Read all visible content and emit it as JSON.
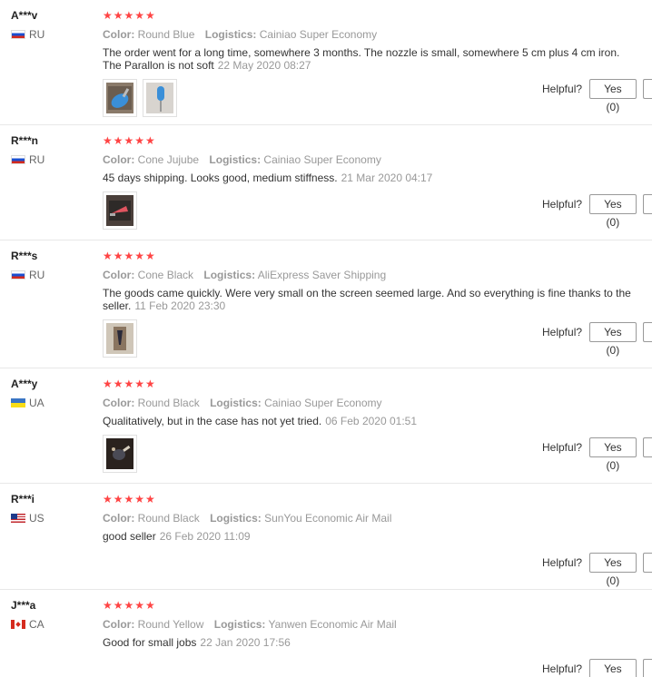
{
  "labels": {
    "color": "Color:",
    "logistics": "Logistics:",
    "helpful": "Helpful?",
    "yes": "Yes (0)",
    "stars": "★★★★★"
  },
  "reviews": [
    {
      "user": "A***v",
      "country": "RU",
      "flag": "russia-flag",
      "color": "Round Blue",
      "logistics": "Cainiao Super Economy",
      "text": "The order went for a long time, somewhere 3 months. The nozzle is small, somewhere 5 cm plus 4 cm iron. The Parallon is not soft",
      "date": "22 May 2020 08:27",
      "photos": [
        "blue-nozzle-photo",
        "blue-drill-bit-photo"
      ]
    },
    {
      "user": "R***n",
      "country": "RU",
      "flag": "russia-flag",
      "color": "Cone Jujube",
      "logistics": "Cainiao Super Economy",
      "text": "45 days shipping. Looks good, medium stiffness.",
      "date": "21 Mar 2020 04:17",
      "photos": [
        "red-cone-photo"
      ]
    },
    {
      "user": "R***s",
      "country": "RU",
      "flag": "russia-flag",
      "color": "Cone Black",
      "logistics": "AliExpress Saver Shipping",
      "text": "The goods came quickly. Were very small on the screen seemed large. And so everything is fine thanks to the seller.",
      "date": "11 Feb 2020 23:30",
      "photos": [
        "black-cone-photo"
      ]
    },
    {
      "user": "A***y",
      "country": "UA",
      "flag": "ukraine-flag",
      "color": "Round Black",
      "logistics": "Cainiao Super Economy",
      "text": "Qualitatively, but in the case has not yet tried.",
      "date": "06 Feb 2020 01:51",
      "photos": [
        "black-round-photo"
      ]
    },
    {
      "user": "R***i",
      "country": "US",
      "flag": "usa-flag",
      "color": "Round Black",
      "logistics": "SunYou Economic Air Mail",
      "text": "good seller",
      "date": "26 Feb 2020 11:09",
      "photos": []
    },
    {
      "user": "J***a",
      "country": "CA",
      "flag": "canada-flag",
      "color": "Round Yellow",
      "logistics": "Yanwen Economic Air Mail",
      "text": "Good for small jobs",
      "date": "22 Jan 2020 17:56",
      "photos": []
    }
  ]
}
